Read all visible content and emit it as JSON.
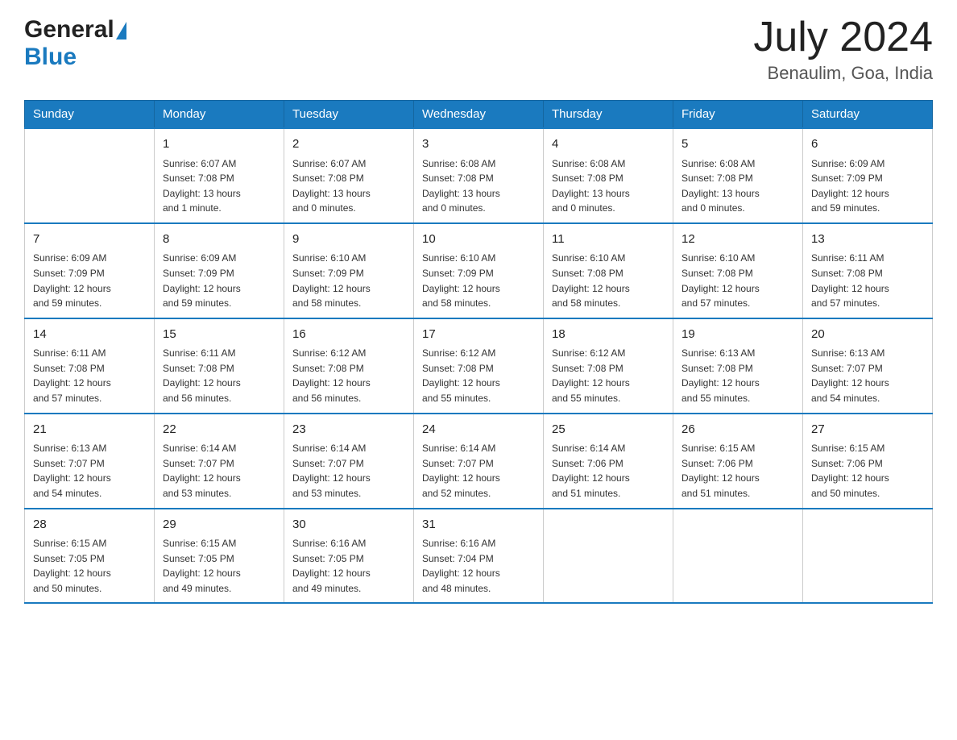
{
  "header": {
    "logo_general": "General",
    "logo_blue": "Blue",
    "month_title": "July 2024",
    "location": "Benaulim, Goa, India"
  },
  "calendar": {
    "days_of_week": [
      "Sunday",
      "Monday",
      "Tuesday",
      "Wednesday",
      "Thursday",
      "Friday",
      "Saturday"
    ],
    "weeks": [
      [
        {
          "day": "",
          "info": ""
        },
        {
          "day": "1",
          "info": "Sunrise: 6:07 AM\nSunset: 7:08 PM\nDaylight: 13 hours\nand 1 minute."
        },
        {
          "day": "2",
          "info": "Sunrise: 6:07 AM\nSunset: 7:08 PM\nDaylight: 13 hours\nand 0 minutes."
        },
        {
          "day": "3",
          "info": "Sunrise: 6:08 AM\nSunset: 7:08 PM\nDaylight: 13 hours\nand 0 minutes."
        },
        {
          "day": "4",
          "info": "Sunrise: 6:08 AM\nSunset: 7:08 PM\nDaylight: 13 hours\nand 0 minutes."
        },
        {
          "day": "5",
          "info": "Sunrise: 6:08 AM\nSunset: 7:08 PM\nDaylight: 13 hours\nand 0 minutes."
        },
        {
          "day": "6",
          "info": "Sunrise: 6:09 AM\nSunset: 7:09 PM\nDaylight: 12 hours\nand 59 minutes."
        }
      ],
      [
        {
          "day": "7",
          "info": "Sunrise: 6:09 AM\nSunset: 7:09 PM\nDaylight: 12 hours\nand 59 minutes."
        },
        {
          "day": "8",
          "info": "Sunrise: 6:09 AM\nSunset: 7:09 PM\nDaylight: 12 hours\nand 59 minutes."
        },
        {
          "day": "9",
          "info": "Sunrise: 6:10 AM\nSunset: 7:09 PM\nDaylight: 12 hours\nand 58 minutes."
        },
        {
          "day": "10",
          "info": "Sunrise: 6:10 AM\nSunset: 7:09 PM\nDaylight: 12 hours\nand 58 minutes."
        },
        {
          "day": "11",
          "info": "Sunrise: 6:10 AM\nSunset: 7:08 PM\nDaylight: 12 hours\nand 58 minutes."
        },
        {
          "day": "12",
          "info": "Sunrise: 6:10 AM\nSunset: 7:08 PM\nDaylight: 12 hours\nand 57 minutes."
        },
        {
          "day": "13",
          "info": "Sunrise: 6:11 AM\nSunset: 7:08 PM\nDaylight: 12 hours\nand 57 minutes."
        }
      ],
      [
        {
          "day": "14",
          "info": "Sunrise: 6:11 AM\nSunset: 7:08 PM\nDaylight: 12 hours\nand 57 minutes."
        },
        {
          "day": "15",
          "info": "Sunrise: 6:11 AM\nSunset: 7:08 PM\nDaylight: 12 hours\nand 56 minutes."
        },
        {
          "day": "16",
          "info": "Sunrise: 6:12 AM\nSunset: 7:08 PM\nDaylight: 12 hours\nand 56 minutes."
        },
        {
          "day": "17",
          "info": "Sunrise: 6:12 AM\nSunset: 7:08 PM\nDaylight: 12 hours\nand 55 minutes."
        },
        {
          "day": "18",
          "info": "Sunrise: 6:12 AM\nSunset: 7:08 PM\nDaylight: 12 hours\nand 55 minutes."
        },
        {
          "day": "19",
          "info": "Sunrise: 6:13 AM\nSunset: 7:08 PM\nDaylight: 12 hours\nand 55 minutes."
        },
        {
          "day": "20",
          "info": "Sunrise: 6:13 AM\nSunset: 7:07 PM\nDaylight: 12 hours\nand 54 minutes."
        }
      ],
      [
        {
          "day": "21",
          "info": "Sunrise: 6:13 AM\nSunset: 7:07 PM\nDaylight: 12 hours\nand 54 minutes."
        },
        {
          "day": "22",
          "info": "Sunrise: 6:14 AM\nSunset: 7:07 PM\nDaylight: 12 hours\nand 53 minutes."
        },
        {
          "day": "23",
          "info": "Sunrise: 6:14 AM\nSunset: 7:07 PM\nDaylight: 12 hours\nand 53 minutes."
        },
        {
          "day": "24",
          "info": "Sunrise: 6:14 AM\nSunset: 7:07 PM\nDaylight: 12 hours\nand 52 minutes."
        },
        {
          "day": "25",
          "info": "Sunrise: 6:14 AM\nSunset: 7:06 PM\nDaylight: 12 hours\nand 51 minutes."
        },
        {
          "day": "26",
          "info": "Sunrise: 6:15 AM\nSunset: 7:06 PM\nDaylight: 12 hours\nand 51 minutes."
        },
        {
          "day": "27",
          "info": "Sunrise: 6:15 AM\nSunset: 7:06 PM\nDaylight: 12 hours\nand 50 minutes."
        }
      ],
      [
        {
          "day": "28",
          "info": "Sunrise: 6:15 AM\nSunset: 7:05 PM\nDaylight: 12 hours\nand 50 minutes."
        },
        {
          "day": "29",
          "info": "Sunrise: 6:15 AM\nSunset: 7:05 PM\nDaylight: 12 hours\nand 49 minutes."
        },
        {
          "day": "30",
          "info": "Sunrise: 6:16 AM\nSunset: 7:05 PM\nDaylight: 12 hours\nand 49 minutes."
        },
        {
          "day": "31",
          "info": "Sunrise: 6:16 AM\nSunset: 7:04 PM\nDaylight: 12 hours\nand 48 minutes."
        },
        {
          "day": "",
          "info": ""
        },
        {
          "day": "",
          "info": ""
        },
        {
          "day": "",
          "info": ""
        }
      ]
    ]
  }
}
